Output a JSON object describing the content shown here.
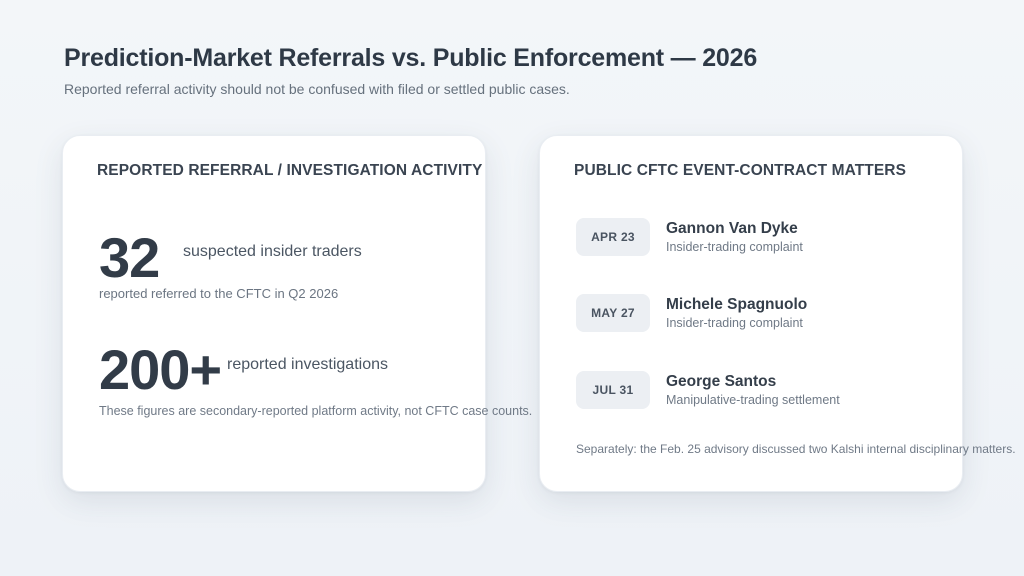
{
  "header": {
    "title": "Prediction-Market Referrals vs. Public Enforcement — 2026",
    "subtitle": "Reported referral activity should not be confused with filed or settled public cases."
  },
  "left_card": {
    "heading": "REPORTED REFERRAL / INVESTIGATION ACTIVITY",
    "stat1": {
      "number": "32",
      "label": "suspected insider traders",
      "note": "reported referred to the CFTC in Q2 2026"
    },
    "stat2": {
      "number": "200+",
      "label": "reported investigations"
    },
    "footnote": "These figures are secondary-reported platform activity, not CFTC case counts."
  },
  "right_card": {
    "heading": "PUBLIC CFTC EVENT-CONTRACT MATTERS",
    "events": [
      {
        "date": "APR 23",
        "name": "Gannon Van Dyke",
        "desc": "Insider-trading complaint"
      },
      {
        "date": "MAY 27",
        "name": "Michele Spagnuolo",
        "desc": "Insider-trading complaint"
      },
      {
        "date": "JUL 31",
        "name": "George Santos",
        "desc": "Manipulative-trading settlement"
      }
    ],
    "footnote": "Separately: the Feb. 25 advisory discussed two Kalshi internal disciplinary matters."
  }
}
